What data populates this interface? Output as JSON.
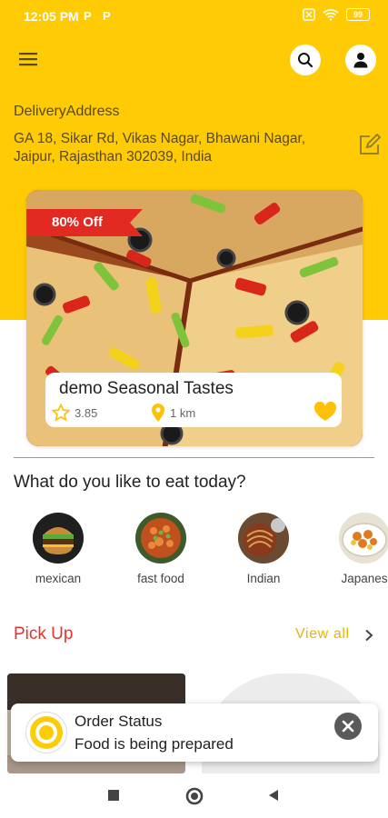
{
  "status_bar": {
    "time": "12:05 PM",
    "notif_1": "P",
    "notif_2": "P",
    "battery": "99"
  },
  "colors": {
    "brand_yellow": "#FFCB05",
    "accent_red": "#E8332B",
    "view_all": "#E8B500"
  },
  "header": {
    "menu_icon": "hamburger-icon",
    "search_icon": "search-icon",
    "profile_icon": "user-icon"
  },
  "address": {
    "label": "DeliveryAddress",
    "text": "GA 18, Sikar Rd, Vikas Nagar, Bhawani Nagar, Jaipur, Rajasthan 302039, India",
    "edit_icon": "edit-icon"
  },
  "featured": {
    "offer": "80% Off",
    "name": "demo Seasonal Tastes",
    "rating": "3.85",
    "distance": "1 km",
    "favorite_icon": "heart-icon"
  },
  "categories": {
    "heading": "What do you like to eat today?",
    "items": [
      {
        "label": "mexican"
      },
      {
        "label": "fast food"
      },
      {
        "label": "Indian"
      },
      {
        "label": "Japanes"
      }
    ]
  },
  "pickup": {
    "title": "Pick Up",
    "view_all": "View all"
  },
  "toast": {
    "title": "Order Status",
    "message": "Food is being prepared",
    "close_icon": "close-icon"
  },
  "nav": {
    "recents_icon": "square-icon",
    "home_icon": "circle-icon",
    "back_icon": "back-triangle-icon"
  }
}
